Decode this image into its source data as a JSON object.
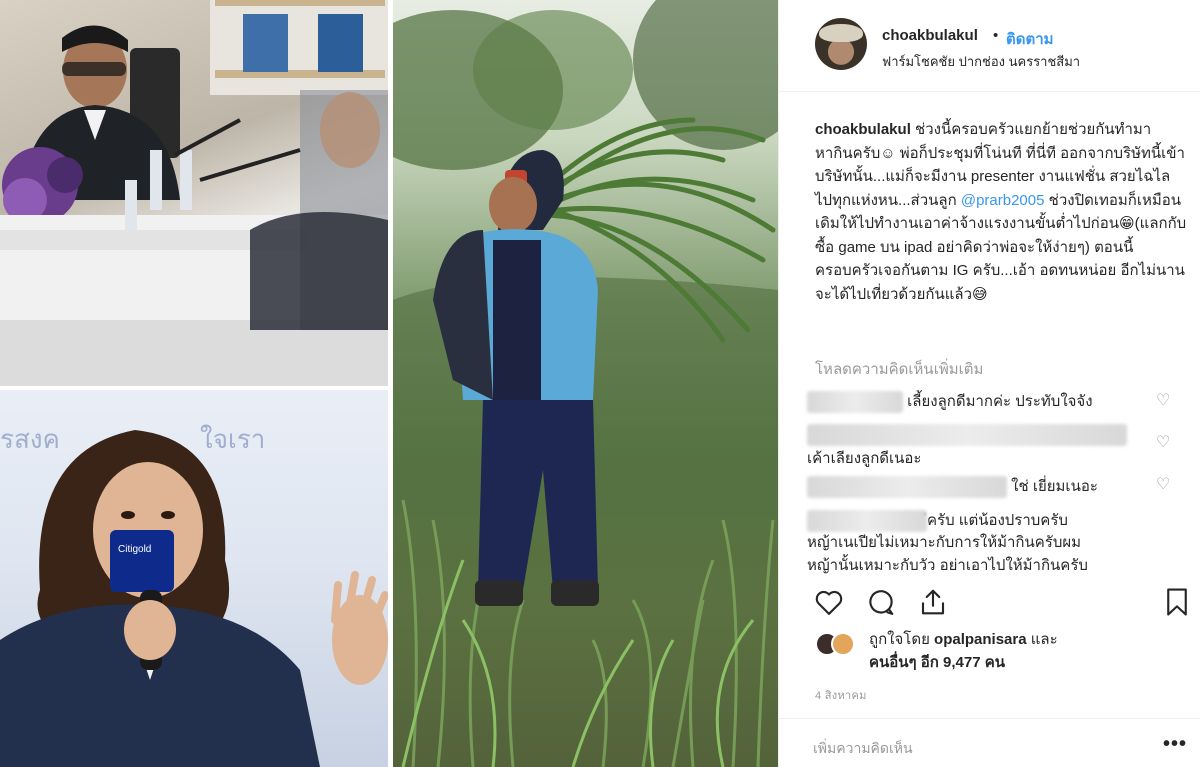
{
  "post": {
    "username": "choakbulakul",
    "separator": "•",
    "follow_label": "ติดตาม",
    "location": "ฟาร์มโชคชัย ปากช่อง นครราชสีมา",
    "caption": {
      "username": "choakbulakul",
      "text_1": " ช่วงนี้ครอบครัวแยกย้ายช่วยกันทำมาหากินครับ☺ พ่อก็ประชุมที่โน่นที ที่นี่ที ออกจากบริษัทนี้เข้าบริษัทนั้น...แม่ก็จะมีงาน presenter งานแฟชั่น สวยไฉไลไปทุกแห่งหน...ส่วนลูก ",
      "mention": "@prarb2005",
      "text_2": " ช่วงปิดเทอมก็เหมือนเดิมให้ไปทำงานเอาค่าจ้างแรงงานขั้นต่ำไปก่อน😁(แลกกับซื้อ game บน ipad อย่าคิดว่าพ่อจะให้ง่ายๆ) ตอนนี้ครอบครัวเจอกันตาม IG ครับ...เอ้า อดทนหน่อย อีกไม่นานจะได้ไปเที่ยวด้วยกันแล้ว😅"
    },
    "load_more": "โหลดความคิดเห็นเพิ่มเติม",
    "comments": [
      {
        "text": "เลี้ยงลูกดีมากค่ะ ประทับใจจัง"
      },
      {
        "text": "เค้าเลียงลูกดีเนอะ"
      },
      {
        "text": "ใช่ เยี่ยมเนอะ"
      },
      {
        "text_1": "ีครับ แต่น้องปราบครับ",
        "text_2": "หญ้าเนเปียไม่เหมาะกับการให้ม้ากินครับผม",
        "text_3": "หญ้านั้นเหมาะกับวัว อย่าเอาไปให้ม้ากินครับ"
      }
    ],
    "likes": {
      "prefix": "ถูกใจโดย ",
      "user": "opalpanisara",
      "middle": " และ",
      "others": "คนอื่นๆ อีก 9,477 คน"
    },
    "timestamp": "4 สิงหาคม",
    "add_comment_placeholder": "เพิ่มความคิดเห็น",
    "more_label": "•••"
  },
  "icons": {
    "like": "heart-icon",
    "comment": "comment-icon",
    "share": "share-icon",
    "save": "bookmark-icon"
  },
  "colors": {
    "link": "#3897f0",
    "muted": "#999999",
    "text": "#262626"
  }
}
